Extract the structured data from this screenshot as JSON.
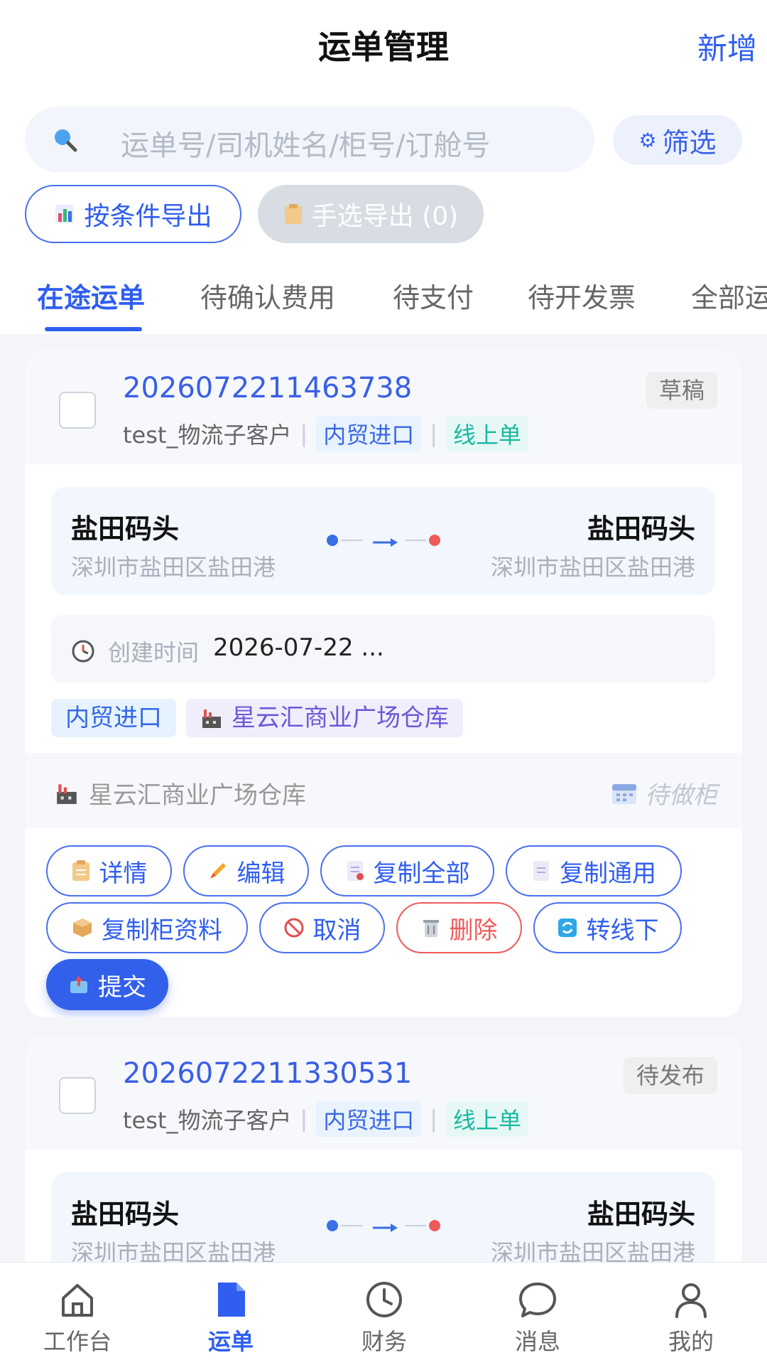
{
  "header": {
    "title": "运单管理",
    "add_label": "新增"
  },
  "search": {
    "placeholder": "运单号/司机姓名/柜号/订舱号",
    "icon": "search-icon"
  },
  "filter": {
    "label": "筛选"
  },
  "export": {
    "conditional_label": "按条件导出",
    "manual_label": "手选导出 (0)"
  },
  "tabs": [
    {
      "label": "在途运单",
      "active": true
    },
    {
      "label": "待确认费用"
    },
    {
      "label": "待支付"
    },
    {
      "label": "待开发票"
    },
    {
      "label": "全部运单"
    }
  ],
  "cards": [
    {
      "waybill_no": "2026072211463738",
      "customer": "test_物流子客户",
      "trade_type": "内贸进口",
      "order_channel": "线上单",
      "status": "草稿",
      "from_name": "盐田码头",
      "from_addr": "深圳市盐田区盐田港",
      "to_name": "盐田码头",
      "to_addr": "深圳市盐田区盐田港",
      "time_label": "创建时间",
      "time_value": "2026-07-22 ...",
      "chip_trade": "内贸进口",
      "chip_warehouse": "星云汇商业广场仓库",
      "warehouse_row": "星云汇商业广场仓库",
      "container_status": "待做柜",
      "actions": {
        "detail": "详情",
        "edit": "编辑",
        "copy_all": "复制全部",
        "copy_common": "复制通用",
        "copy_container": "复制柜资料",
        "cancel": "取消",
        "delete": "删除",
        "to_offline": "转线下",
        "submit": "提交"
      }
    },
    {
      "waybill_no": "2026072211330531",
      "customer": "test_物流子客户",
      "trade_type": "内贸进口",
      "order_channel": "线上单",
      "status": "待发布",
      "from_name": "盐田码头",
      "from_addr": "深圳市盐田区盐田港",
      "to_name": "盐田码头",
      "to_addr": "深圳市盐田区盐田港"
    }
  ],
  "bottom_nav": [
    {
      "label": "工作台",
      "icon": "home-icon"
    },
    {
      "label": "运单",
      "icon": "document-icon",
      "active": true
    },
    {
      "label": "财务",
      "icon": "clock-icon"
    },
    {
      "label": "消息",
      "icon": "chat-icon"
    },
    {
      "label": "我的",
      "icon": "user-icon"
    }
  ],
  "colors": {
    "accent": "#2f5ef0",
    "danger": "#f05a5a",
    "online_tag": "#18b8a2"
  }
}
